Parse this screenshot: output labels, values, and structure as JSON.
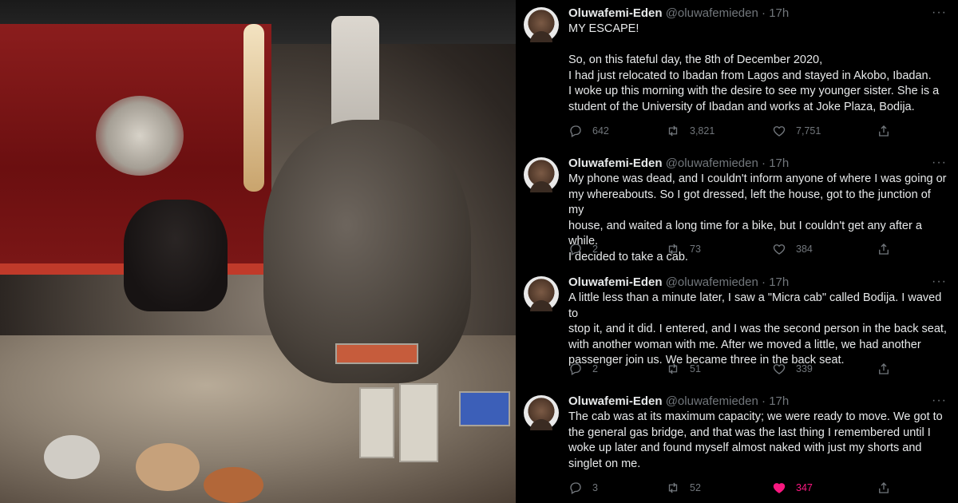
{
  "colors": {
    "background": "#000000",
    "text": "#e7e9ea",
    "muted": "#71767b",
    "like": "#f91880"
  },
  "tweets": [
    {
      "name": "Oluwafemi-Eden",
      "handle": "@oluwafemieden",
      "time": "17h",
      "text": "MY ESCAPE!\n\nSo, on this fateful day, the 8th of December 2020,\nI had just relocated to Ibadan from Lagos and stayed in Akobo, Ibadan.\nI woke up this morning with the desire to see my younger sister. She is a\nstudent of the University of Ibadan and works at Joke Plaza, Bodija.",
      "replies": "642",
      "retweets": "3,821",
      "likes": "7,751",
      "liked": false
    },
    {
      "name": "Oluwafemi-Eden",
      "handle": "@oluwafemieden",
      "time": "17h",
      "text": "My phone was dead, and I couldn't inform anyone of where I was going or\nmy whereabouts. So I got dressed, left the house, got to the junction of my\nhouse, and waited a long time for a bike, but I couldn't get any after a while.\nI decided to take a cab.",
      "replies": "2",
      "retweets": "73",
      "likes": "384",
      "liked": false
    },
    {
      "name": "Oluwafemi-Eden",
      "handle": "@oluwafemieden",
      "time": "17h",
      "text": "A little less than a minute later, I saw a \"Micra cab\" called Bodija. I waved to\nstop it, and it did. I entered, and I was the second person in the back seat,\nwith another woman with me. After we moved a little, we had another\npassenger join us. We became three in the back seat.",
      "replies": "2",
      "retweets": "51",
      "likes": "339",
      "liked": false
    },
    {
      "name": "Oluwafemi-Eden",
      "handle": "@oluwafemieden",
      "time": "17h",
      "text": "The cab was at its maximum capacity; we were ready to move. We got to\nthe general gas bridge, and that was the last thing I remembered until I\nwoke up later and found myself almost naked with just my shorts and\nsinglet on me.",
      "replies": "3",
      "retweets": "52",
      "likes": "347",
      "liked": true
    }
  ],
  "icons": {
    "reply": "reply-icon",
    "retweet": "retweet-icon",
    "like": "heart-icon",
    "share": "share-icon",
    "more": "more-icon"
  }
}
